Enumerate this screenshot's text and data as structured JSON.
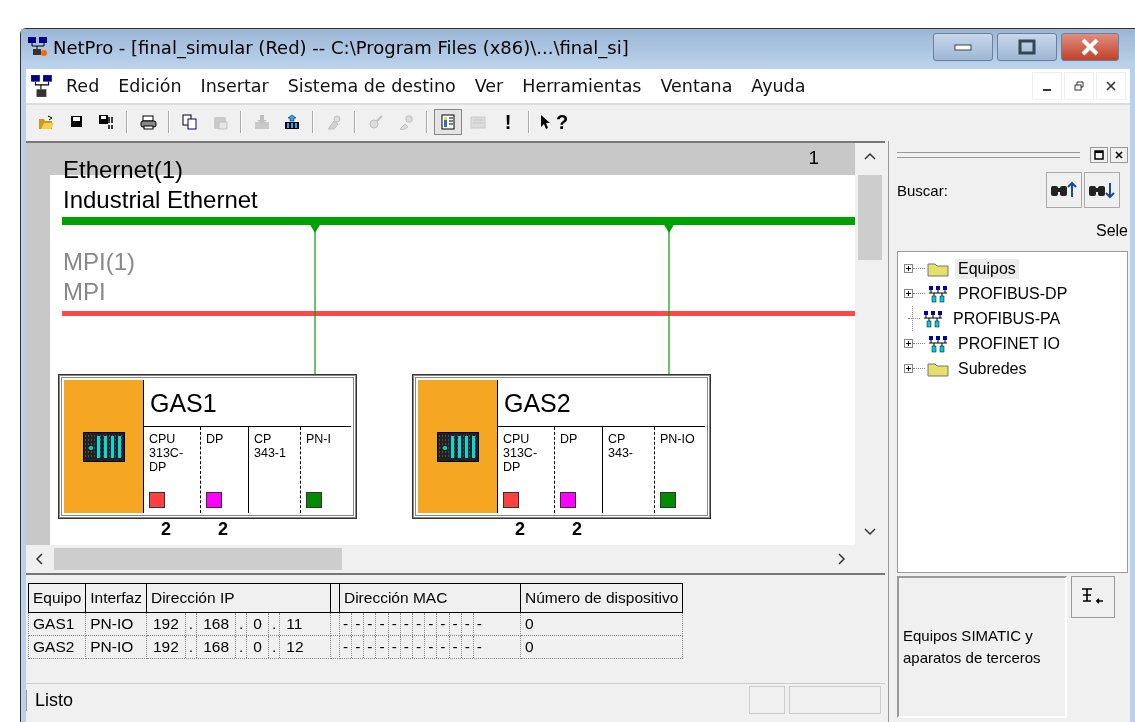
{
  "window": {
    "title": "NetPro - [final_simular (Red) -- C:\\Program Files (x86)\\...\\final_si]"
  },
  "menu": [
    "Red",
    "Edición",
    "Insertar",
    "Sistema de destino",
    "Ver",
    "Herramientas",
    "Ventana",
    "Ayuda"
  ],
  "toolbar_groups": [
    {
      "buttons": [
        {
          "disabled": false,
          "pressed": false
        },
        {
          "disabled": false,
          "pressed": false
        },
        {
          "disabled": false,
          "pressed": false
        }
      ]
    },
    {
      "buttons": [
        {
          "disabled": false,
          "pressed": false
        }
      ]
    },
    {
      "buttons": [
        {
          "disabled": false,
          "pressed": false
        },
        {
          "disabled": true,
          "pressed": false
        }
      ]
    },
    {
      "buttons": [
        {
          "disabled": true,
          "pressed": false
        },
        {
          "disabled": false,
          "pressed": false
        }
      ]
    },
    {
      "buttons": [
        {
          "disabled": true,
          "pressed": false
        }
      ]
    },
    {
      "buttons": [
        {
          "disabled": true,
          "pressed": false
        },
        {
          "disabled": true,
          "pressed": false
        }
      ]
    },
    {
      "buttons": [
        {
          "disabled": false,
          "pressed": true
        },
        {
          "disabled": true,
          "pressed": false
        },
        {
          "disabled": false,
          "pressed": false,
          "label": "!"
        }
      ]
    },
    {
      "buttons": [
        {
          "disabled": false,
          "pressed": false,
          "label": "?"
        }
      ]
    }
  ],
  "network_view": {
    "page": "1",
    "subnets": [
      {
        "name": "Ethernet(1)",
        "type": "Industrial Ethernet",
        "color": "#00a000"
      },
      {
        "name": "MPI(1)",
        "type": "MPI",
        "color": "#ff4848"
      }
    ],
    "stations": [
      {
        "name": "GAS1",
        "connected": true,
        "modules": [
          {
            "lines": [
              "CPU",
              "313C-",
              "DP"
            ],
            "color": "#ff4040",
            "address": "2"
          },
          {
            "lines": [
              "DP"
            ],
            "color": "#ff00ff",
            "address": "2"
          },
          {
            "lines": [
              "CP",
              "343-1"
            ]
          },
          {
            "lines": [
              "PN-I"
            ],
            "color": "#008c00"
          }
        ]
      },
      {
        "name": "GAS2",
        "connected": true,
        "modules": [
          {
            "lines": [
              "CPU",
              "313C-",
              "DP"
            ],
            "color": "#ff4040",
            "address": "2"
          },
          {
            "lines": [
              "DP"
            ],
            "color": "#ff00ff",
            "address": "2"
          },
          {
            "lines": [
              "CP",
              "343-"
            ]
          },
          {
            "lines": [
              "PN-IO"
            ],
            "color": "#008c00"
          }
        ]
      }
    ]
  },
  "catalog": {
    "search_label": "Buscar:",
    "cut_label": "Sele",
    "tree": [
      {
        "label": "Equipos",
        "kind": "folder",
        "expandable": true,
        "selected": true
      },
      {
        "label": "PROFIBUS-DP",
        "kind": "network",
        "expandable": true,
        "selected": false
      },
      {
        "label": "PROFIBUS-PA",
        "kind": "network",
        "expandable": false,
        "selected": false
      },
      {
        "label": "PROFINET IO",
        "kind": "network",
        "expandable": true,
        "selected": false
      },
      {
        "label": "Subredes",
        "kind": "folder",
        "expandable": true,
        "selected": false
      }
    ],
    "description": "Equipos SIMATIC y aparatos de terceros"
  },
  "address_table": {
    "columns": [
      "Equipo",
      "Interfaz",
      "Dirección IP",
      "Dirección MAC",
      "Número de dispositivo"
    ],
    "rows": [
      {
        "device": "GAS1",
        "interface": "PN-IO",
        "ip": [
          "192",
          ".",
          "168",
          ".",
          "0",
          ".",
          "11"
        ],
        "mac": [
          "-",
          "-",
          "-",
          "-",
          "-",
          "-",
          "-",
          "-",
          "-",
          "-",
          "-",
          "-"
        ],
        "device_number": "0"
      },
      {
        "device": "GAS2",
        "interface": "PN-IO",
        "ip": [
          "192",
          ".",
          "168",
          ".",
          "0",
          ".",
          "12"
        ],
        "mac": [
          "-",
          "-",
          "-",
          "-",
          "-",
          "-",
          "-",
          "-",
          "-",
          "-",
          "-",
          "-"
        ],
        "device_number": "0"
      }
    ]
  },
  "status_bar": {
    "text": "Listo"
  }
}
